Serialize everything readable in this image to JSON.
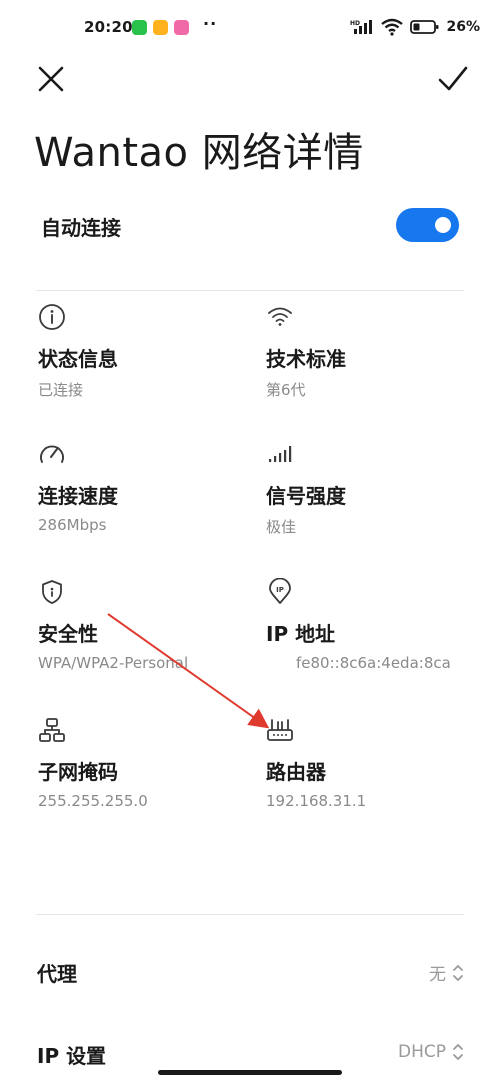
{
  "status_bar": {
    "time": "20:20",
    "dots": "··",
    "battery_percent": "26%",
    "network_label": "HD",
    "apps": [
      {
        "name": "wechat-icon",
        "color": "#29c24a"
      },
      {
        "name": "app-icon-orange",
        "color": "#ffb21e"
      },
      {
        "name": "app-icon-pink",
        "color": "#f06aa8"
      }
    ]
  },
  "header": {
    "title": "Wantao 网络详情"
  },
  "auto_connect": {
    "label": "自动连接",
    "enabled": true,
    "accent_color": "#1677ee"
  },
  "details": [
    {
      "title": "状态信息",
      "value": "已连接",
      "icon": "info-icon"
    },
    {
      "title": "技术标准",
      "value": "第6代",
      "icon": "wifi-icon"
    },
    {
      "title": "连接速度",
      "value": "286Mbps",
      "icon": "speed-gauge-icon"
    },
    {
      "title": "信号强度",
      "value": "极佳",
      "icon": "signal-bars-icon"
    },
    {
      "title": "安全性",
      "value": "WPA/WPA2-Personal",
      "icon": "shield-icon"
    },
    {
      "title": "IP 地址",
      "value": "fe80::8c6a:4eda:8ca",
      "icon": "ip-pin-icon"
    },
    {
      "title": "子网掩码",
      "value": "255.255.255.0",
      "icon": "network-topology-icon"
    },
    {
      "title": "路由器",
      "value": "192.168.31.1",
      "icon": "router-icon"
    }
  ],
  "settings": [
    {
      "label": "代理",
      "value": "无"
    },
    {
      "label": "IP 设置",
      "value": "DHCP"
    }
  ],
  "annotation": {
    "arrow_color": "#e03a2f"
  }
}
